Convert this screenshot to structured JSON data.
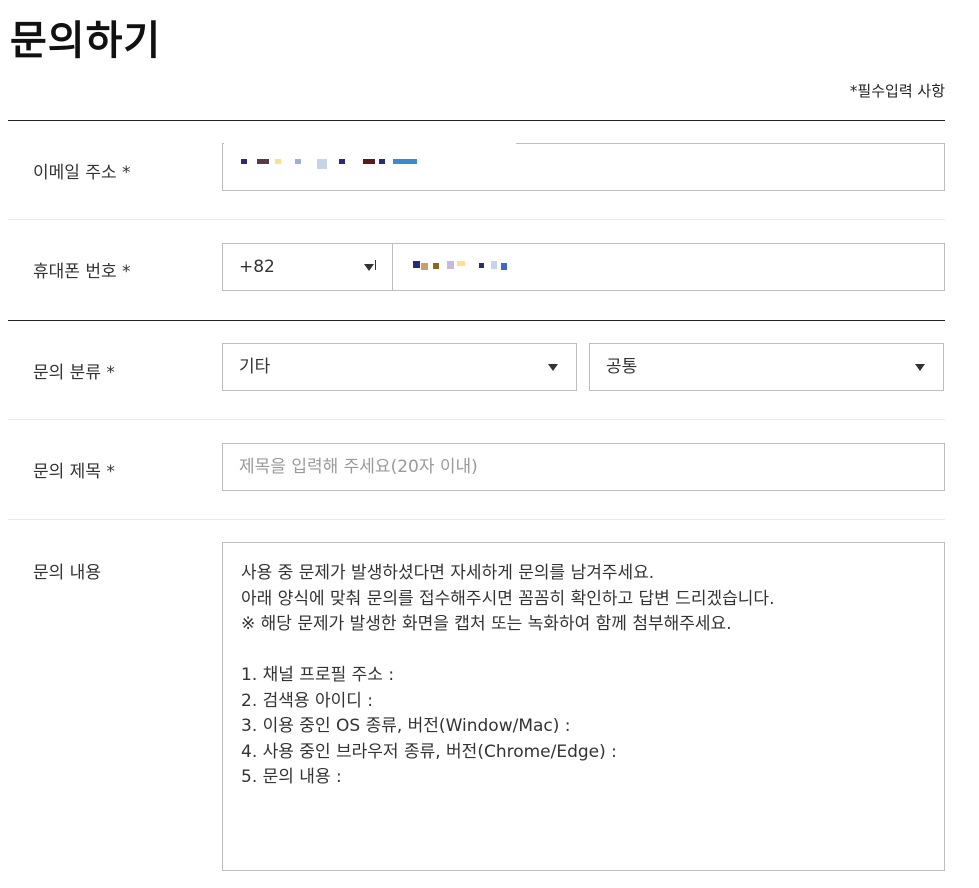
{
  "page": {
    "title": "문의하기",
    "required_note": "*필수입력 사항"
  },
  "form": {
    "email": {
      "label": "이메일 주소 *",
      "value": ""
    },
    "phone": {
      "label": "휴대폰 번호 *",
      "country_code": "+82",
      "value": ""
    },
    "category": {
      "label": "문의 분류 *",
      "primary_selected": "기타",
      "secondary_selected": "공통"
    },
    "subject": {
      "label": "문의 제목 *",
      "placeholder": "제목을 입력해 주세요(20자 이내)"
    },
    "content": {
      "label": "문의 내용",
      "lines": [
        "사용 중 문제가 발생하셨다면 자세하게 문의를 남겨주세요.",
        "아래 양식에 맞춰 문의를 접수해주시면 꼼꼼히 확인하고 답변 드리겠습니다.",
        "※ 해당 문제가 발생한 화면을 캡처 또는 녹화하여 함께 첨부해주세요.",
        "",
        "1. 채널 프로필 주소 :",
        "2. 검색용 아이디 :",
        "3. 이용 중인 OS 종류, 버전(Window/Mac) :",
        "4. 사용 중인 브라우저 종류, 버전(Chrome/Edge) :",
        "5. 문의 내용 :"
      ]
    }
  },
  "colors": {
    "border": "#bdbdbd",
    "text": "#333333",
    "placeholder": "#9a9a9a",
    "divider_dark": "#222222",
    "divider_light": "#e9e9e9"
  },
  "icons": {
    "dropdown": "caret-down-icon"
  }
}
